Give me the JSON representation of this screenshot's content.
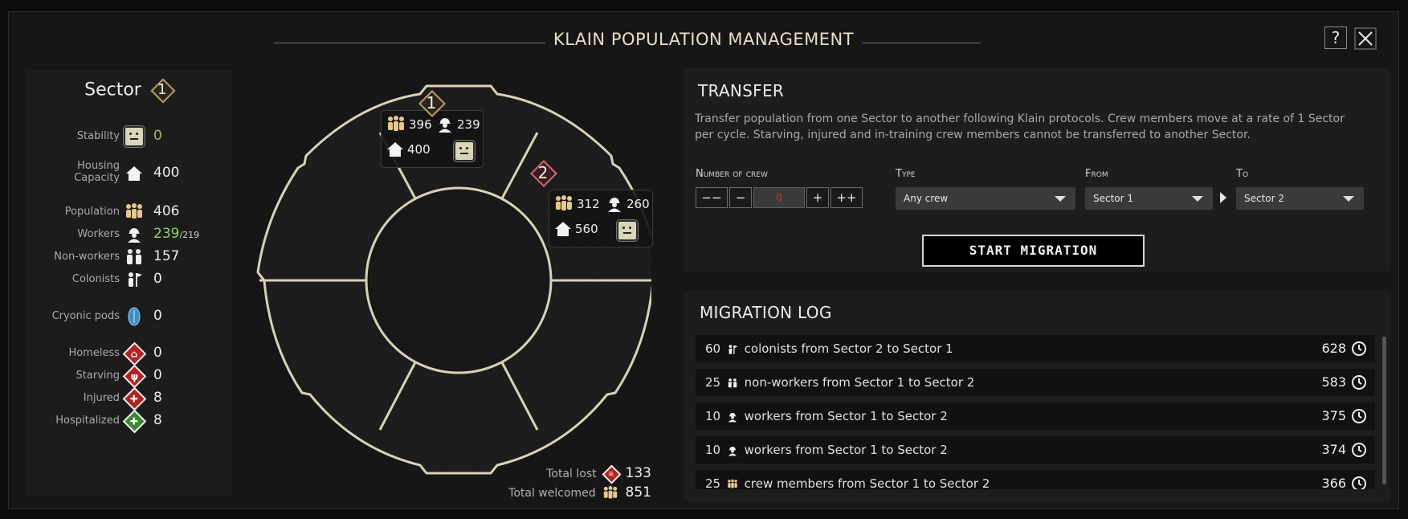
{
  "window": {
    "title": "KLAIN POPULATION MANAGEMENT",
    "help_label": "?",
    "close_label": "✕"
  },
  "sector_panel": {
    "label": "Sector",
    "number": "1",
    "stats": [
      {
        "label": "Stability",
        "value": "0",
        "icon": "neutral-face-icon"
      },
      {
        "label": "Housing Capacity",
        "value": "400",
        "icon": "house-icon"
      },
      {
        "label": "Population",
        "value": "406",
        "icon": "population-icon"
      },
      {
        "label": "Workers",
        "value": "239",
        "sub": "/219",
        "icon": "worker-icon"
      },
      {
        "label": "Non-workers",
        "value": "157",
        "icon": "non-worker-icon"
      },
      {
        "label": "Colonists",
        "value": "0",
        "icon": "colonist-flag-icon"
      },
      {
        "label": "Cryonic pods",
        "value": "0",
        "icon": "cryo-pod-icon"
      },
      {
        "label": "Homeless",
        "value": "0",
        "icon": "homeless-icon"
      },
      {
        "label": "Starving",
        "value": "0",
        "icon": "starving-icon"
      },
      {
        "label": "Injured",
        "value": "8",
        "icon": "injured-icon"
      },
      {
        "label": "Hospitalized",
        "value": "8",
        "icon": "hospitalized-icon"
      }
    ],
    "colors": {
      "stability": "#b6b05a",
      "workers_over": "#8fd46a",
      "alert": "#b81f1f",
      "hospital": "#3b8a30"
    }
  },
  "ring": {
    "sectors": [
      {
        "number": "1",
        "population": "396",
        "workers": "239",
        "housing": "400",
        "status_icon": "neutral-face-icon"
      },
      {
        "number": "2",
        "population": "312",
        "workers": "260",
        "housing": "560",
        "status_icon": "neutral-face-icon"
      }
    ],
    "total_lost_label": "Total lost",
    "total_lost": "133",
    "total_welcomed_label": "Total welcomed",
    "total_welcomed": "851"
  },
  "transfer": {
    "title": "TRANSFER",
    "description": "Transfer population from one Sector to another following Klain protocols. Crew members move at a rate of 1 Sector per cycle. Starving, injured and in-training crew members cannot be transferred to another Sector.",
    "crew_label": "Number of crew",
    "crew_value": "0",
    "dec_big": "−−",
    "dec": "−",
    "inc": "+",
    "inc_big": "++",
    "type_label": "Type",
    "type_value": "Any crew",
    "from_label": "From",
    "from_value": "Sector 1",
    "to_label": "To",
    "to_value": "Sector 2",
    "start_label": "START MIGRATION"
  },
  "migration_log": {
    "title": "MIGRATION LOG",
    "entries": [
      {
        "count": "60",
        "icon": "colonist-flag-icon",
        "text": "colonists from Sector 2 to Sector 1",
        "time": "628"
      },
      {
        "count": "25",
        "icon": "non-worker-icon",
        "text": "non-workers from Sector 1 to Sector 2",
        "time": "583"
      },
      {
        "count": "10",
        "icon": "worker-icon",
        "text": "workers from Sector 1 to Sector 2",
        "time": "375"
      },
      {
        "count": "10",
        "icon": "worker-icon",
        "text": "workers from Sector 1 to Sector 2",
        "time": "374"
      },
      {
        "count": "25",
        "icon": "population-icon",
        "text": "crew members from Sector 1 to Sector 2",
        "time": "366"
      }
    ]
  }
}
